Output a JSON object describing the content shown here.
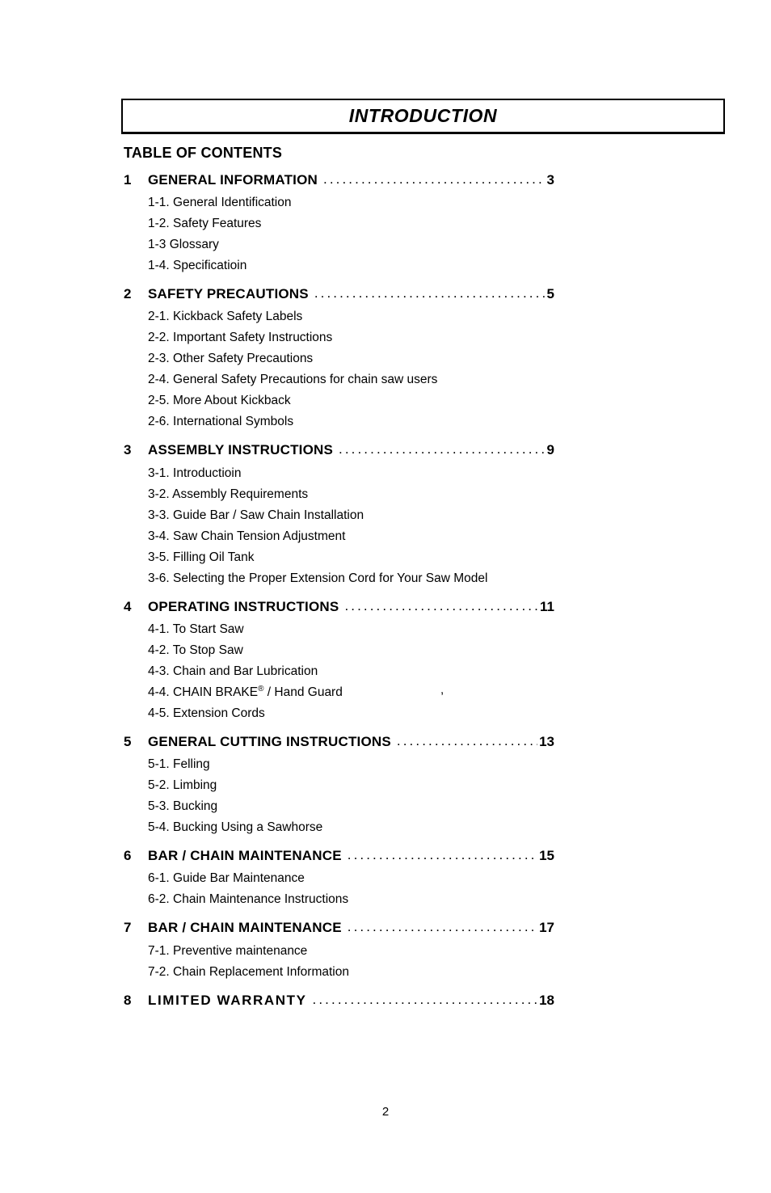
{
  "header": {
    "title": "INTRODUCTION"
  },
  "toc": {
    "heading": "TABLE OF CONTENTS",
    "sections": [
      {
        "num": "1",
        "title": "GENERAL INFORMATION",
        "page": "3",
        "subsections": [
          "1-1. General Identification",
          "1-2. Safety Features",
          "1-3 Glossary",
          "1-4. Specificatioin"
        ]
      },
      {
        "num": "2",
        "title": "SAFETY PRECAUTIONS",
        "page": "5",
        "subsections": [
          "2-1. Kickback Safety Labels",
          "2-2. Important Safety Instructions",
          "2-3. Other Safety Precautions",
          "2-4. General Safety Precautions for chain saw users",
          "2-5. More About Kickback",
          "2-6. International Symbols"
        ]
      },
      {
        "num": "3",
        "title": "ASSEMBLY INSTRUCTIONS",
        "page": "9",
        "subsections": [
          "3-1. Introductioin",
          "3-2. Assembly Requirements",
          "3-3. Guide Bar / Saw Chain Installation",
          "3-4. Saw Chain Tension Adjustment",
          "3-5. Filling Oil Tank",
          "3-6. Selecting the Proper Extension Cord for Your Saw Model"
        ]
      },
      {
        "num": "4",
        "title": "OPERATING INSTRUCTIONS",
        "page": "11",
        "subsections": [
          "4-1. To Start Saw",
          "4-2. To Stop Saw",
          "4-3. Chain and Bar Lubrication",
          "4-4. CHAIN BRAKE® / Hand Guard",
          "4-5. Extension Cords"
        ]
      },
      {
        "num": "5",
        "title": "GENERAL CUTTING INSTRUCTIONS",
        "page": "13",
        "subsections": [
          "5-1. Felling",
          "5-2. Limbing",
          "5-3. Bucking",
          "5-4. Bucking Using a Sawhorse"
        ]
      },
      {
        "num": "6",
        "title": "BAR / CHAIN MAINTENANCE",
        "page": "15",
        "subsections": [
          "6-1. Guide Bar Maintenance",
          "6-2. Chain Maintenance Instructions"
        ]
      },
      {
        "num": "7",
        "title": "BAR / CHAIN MAINTENANCE",
        "page": "17",
        "subsections": [
          "7-1. Preventive maintenance",
          "7-2. Chain Replacement Information"
        ]
      },
      {
        "num": "8",
        "title": "LIMITED WARRANTY",
        "page": "18",
        "subsections": []
      }
    ]
  },
  "footer": {
    "page_number": "2"
  },
  "artifacts": {
    "stray_mark": ","
  }
}
